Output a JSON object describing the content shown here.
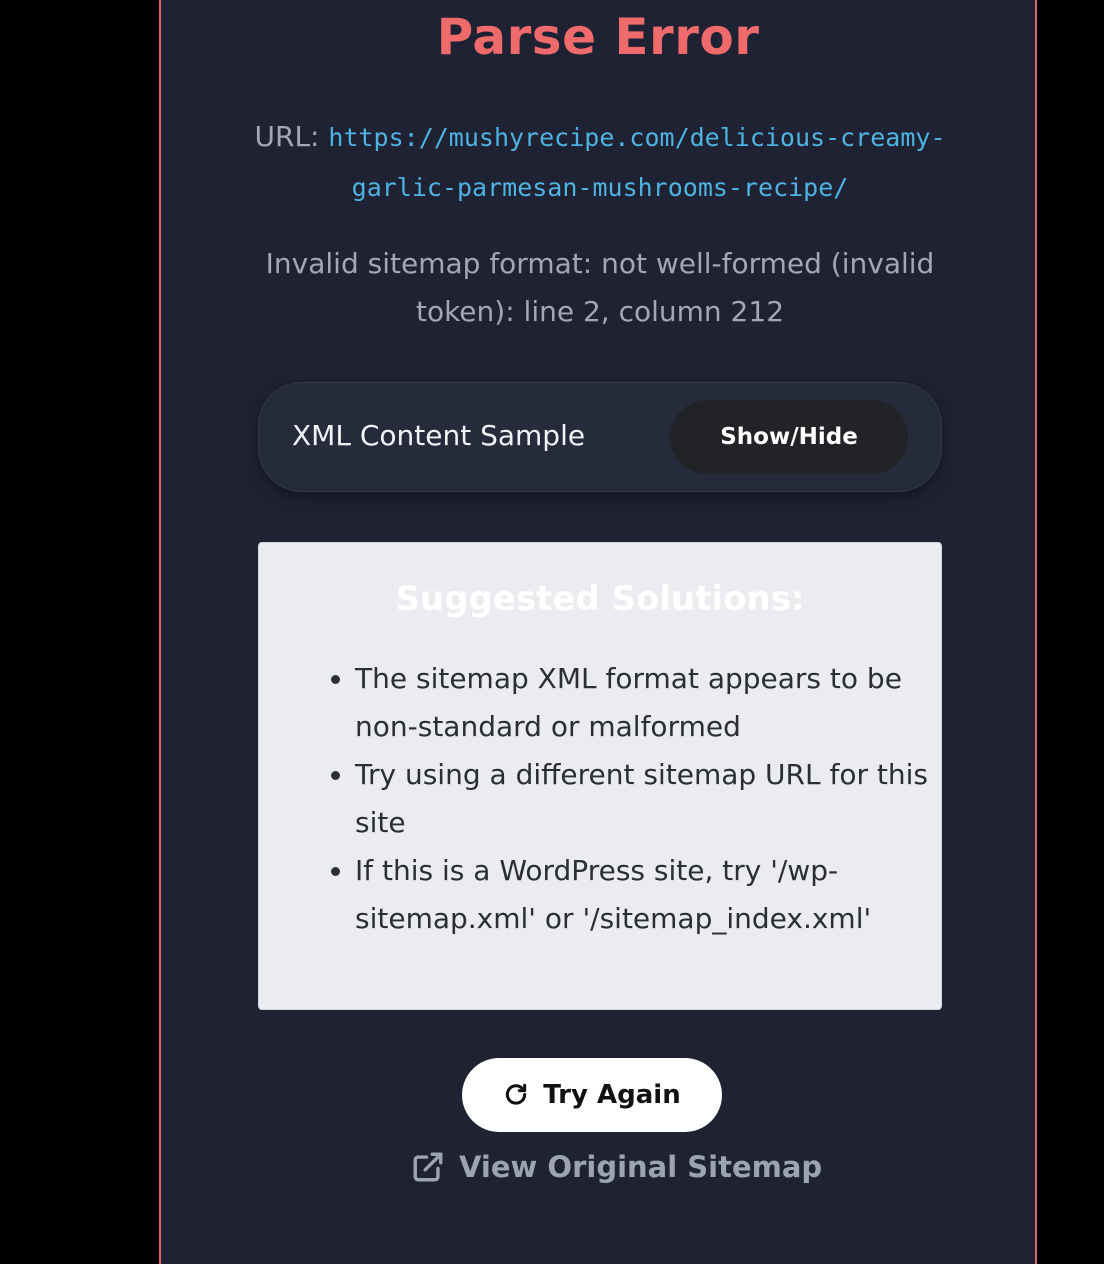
{
  "error": {
    "title": "Parse Error",
    "url_label": "URL:",
    "url": "https://mushyrecipe.com/delicious-creamy-garlic-parmesan-mushrooms-recipe/",
    "message": "Invalid sitemap format: not well-formed (invalid token): line 2, column 212"
  },
  "sample": {
    "label": "XML Content Sample",
    "toggle_label": "Show/Hide"
  },
  "solutions": {
    "title": "Suggested Solutions:",
    "items": [
      "The sitemap XML format appears to be non-standard or malformed",
      "Try using a different sitemap URL for this site",
      "If this is a WordPress site, try '/wp-sitemap.xml' or '/sitemap_index.xml'"
    ]
  },
  "actions": {
    "try_again_label": "Try Again",
    "try_again_icon": "refresh-icon",
    "view_original_label": "View Original Sitemap",
    "view_original_icon": "external-link-icon"
  },
  "colors": {
    "accent_error": "#ef6b6b",
    "link": "#4fb3e2",
    "panel_background": "#1e2233"
  }
}
